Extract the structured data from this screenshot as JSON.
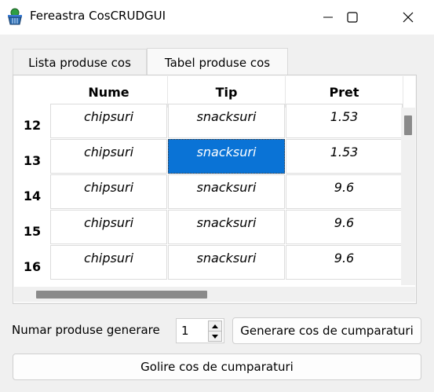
{
  "window": {
    "title": "Fereastra CosCRUDGUI",
    "icon": "shopping-basket-icon"
  },
  "tabs": [
    {
      "label": "Lista produse cos",
      "active": false
    },
    {
      "label": "Tabel produse cos",
      "active": true
    }
  ],
  "table": {
    "columns": [
      "Nume",
      "Tip",
      "Pret"
    ],
    "rows": [
      {
        "index": "12",
        "cells": [
          "chipsuri",
          "snacksuri",
          "1.53"
        ]
      },
      {
        "index": "13",
        "cells": [
          "chipsuri",
          "snacksuri",
          "1.53"
        ]
      },
      {
        "index": "14",
        "cells": [
          "chipsuri",
          "snacksuri",
          "9.6"
        ]
      },
      {
        "index": "15",
        "cells": [
          "chipsuri",
          "snacksuri",
          "9.6"
        ]
      },
      {
        "index": "16",
        "cells": [
          "chipsuri",
          "snacksuri",
          "9.6"
        ]
      }
    ],
    "selected_color": "#0a73d6"
  },
  "controls": {
    "generate_label": "Numar produse generare",
    "spinner_value": "1",
    "generate_button": "Generare cos de cumparaturi",
    "clear_button": "Golire cos de cumparaturi"
  }
}
